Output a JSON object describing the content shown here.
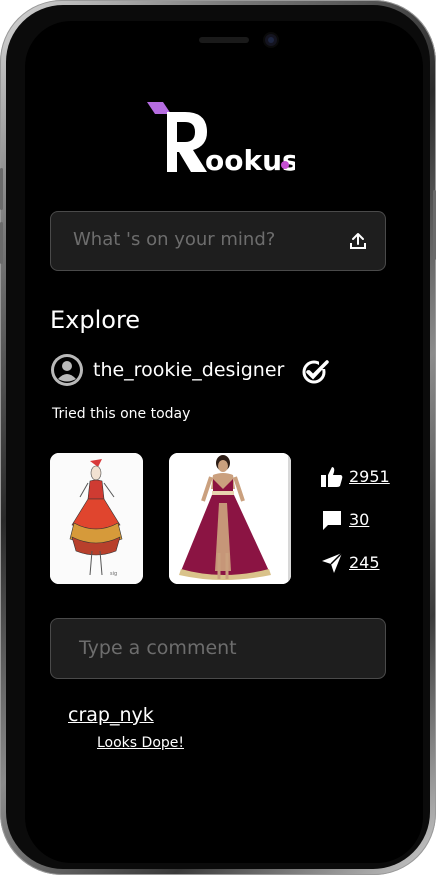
{
  "app": {
    "brand_name": "Rookus",
    "brand_dot_color": "#c34fd1",
    "brand_slash_color": "#b56ce0"
  },
  "composer": {
    "placeholder": "What 's  on your mind?",
    "upload_icon": "upload-icon"
  },
  "explore": {
    "title": "Explore"
  },
  "post": {
    "author": "the_rookie_designer",
    "verified_icon": "verified-check-icon",
    "caption": "Tried this one today",
    "images": [
      "dress-sketch",
      "burgundy-gown-photo"
    ],
    "stats": {
      "likes": "2951",
      "comments": "30",
      "shares": "245"
    }
  },
  "comment_input": {
    "placeholder": "Type a comment"
  },
  "comments": [
    {
      "user": "crap_nyk",
      "text": "Looks Dope!"
    }
  ]
}
